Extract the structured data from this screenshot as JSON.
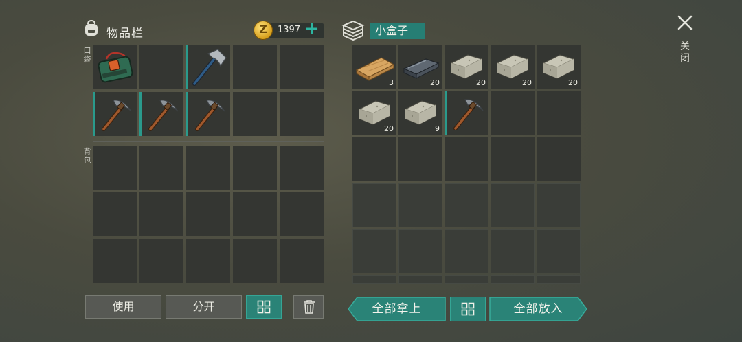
{
  "header": {
    "title": "物品栏",
    "coins": "1397",
    "coin_symbol": "Z",
    "add_symbol": "+"
  },
  "container": {
    "name": "小盒子"
  },
  "close": {
    "label": "关闭"
  },
  "sections": {
    "pocket_label": "口袋",
    "backpack_label": "背包"
  },
  "inventory": {
    "pocket": [
      {
        "item": "backpack",
        "qty": ""
      },
      {
        "item": "",
        "qty": ""
      },
      {
        "item": "hatchet",
        "qty": ""
      },
      {
        "item": "",
        "qty": ""
      },
      {
        "item": "",
        "qty": ""
      },
      {
        "item": "pickaxe",
        "qty": ""
      },
      {
        "item": "pickaxe",
        "qty": ""
      },
      {
        "item": "pickaxe",
        "qty": ""
      },
      {
        "item": "",
        "qty": ""
      },
      {
        "item": "",
        "qty": ""
      }
    ],
    "backpack_slots": 15
  },
  "box": {
    "items": [
      {
        "item": "wood-plank",
        "qty": "3"
      },
      {
        "item": "iron-bar",
        "qty": "20"
      },
      {
        "item": "stone",
        "qty": "20"
      },
      {
        "item": "stone",
        "qty": "20"
      },
      {
        "item": "stone",
        "qty": "20"
      },
      {
        "item": "stone",
        "qty": "20"
      },
      {
        "item": "stone",
        "qty": "9"
      },
      {
        "item": "pickaxe",
        "qty": ""
      }
    ]
  },
  "buttons": {
    "use": "使用",
    "split": "分开",
    "take_all": "全部拿上",
    "put_all": "全部放入"
  },
  "colors": {
    "accent": "#2a8377",
    "slot": "#343632",
    "background": "#4a4b3f"
  }
}
